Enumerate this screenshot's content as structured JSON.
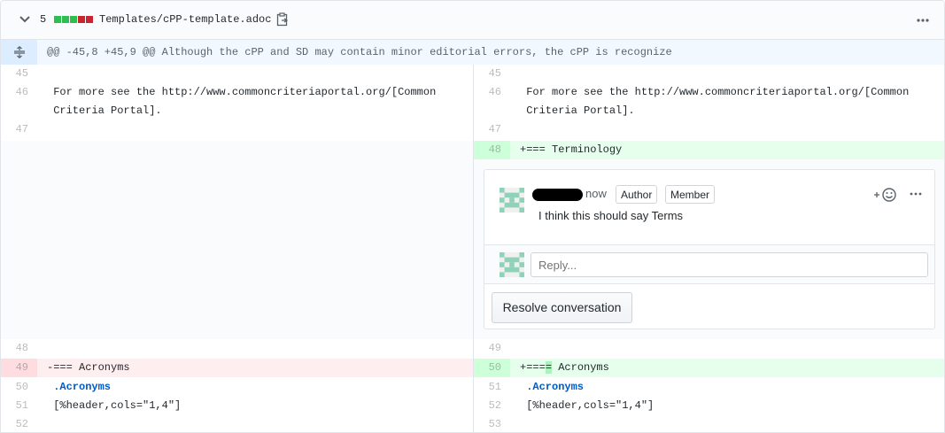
{
  "file": {
    "added_count": "5",
    "diffstat_colors": [
      "#2cbe4e",
      "#2cbe4e",
      "#2cbe4e",
      "#cb2431",
      "#cb2431"
    ],
    "path": "Templates/cPP-template.adoc"
  },
  "hunk": {
    "header": "@@ -45,8 +45,9 @@ Although the cPP and SD may contain minor editorial errors, the cPP is recognize"
  },
  "left": {
    "lines": [
      {
        "num": "45",
        "text": ""
      },
      {
        "num": "46",
        "text": " For more see the http://www.commoncriteriaportal.org/[Common"
      },
      {
        "num": "",
        "text": " Criteria Portal]."
      },
      {
        "num": "47",
        "text": ""
      },
      {
        "num": "48",
        "text": ""
      },
      {
        "num": "49",
        "text": "-=== Acronyms"
      },
      {
        "num": "50",
        "text": " .Acronyms"
      },
      {
        "num": "51",
        "text": " [%header,cols=\"1,4\"]"
      },
      {
        "num": "52",
        "text": ""
      }
    ]
  },
  "right": {
    "lines": [
      {
        "num": "45",
        "text": ""
      },
      {
        "num": "46",
        "text": " For more see the http://www.commoncriteriaportal.org/[Common"
      },
      {
        "num": "",
        "text": " Criteria Portal]."
      },
      {
        "num": "47",
        "text": ""
      },
      {
        "num": "48",
        "text": "+=== Terminology"
      },
      {
        "num": "49",
        "text": ""
      },
      {
        "num": "50",
        "text_prefix": "+===",
        "text_highlight": "=",
        "text_suffix": " Acronyms"
      },
      {
        "num": "51",
        "text": " .Acronyms"
      },
      {
        "num": "52",
        "text": " [%header,cols=\"1,4\"]"
      },
      {
        "num": "53",
        "text": ""
      }
    ]
  },
  "thread": {
    "time": "now",
    "badge_author": "Author",
    "badge_member": "Member",
    "body": "I think this should say Terms",
    "reply_placeholder": "Reply...",
    "resolve_label": "Resolve conversation"
  }
}
